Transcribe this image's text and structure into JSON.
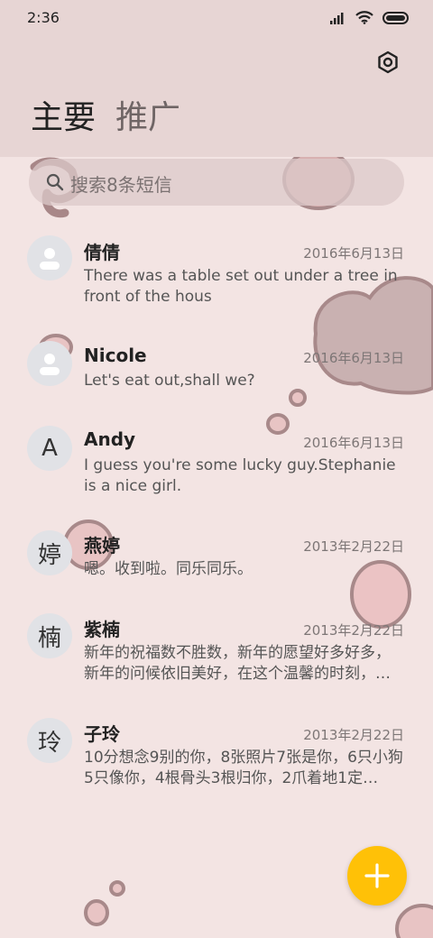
{
  "status_bar": {
    "time": "2:36"
  },
  "header": {
    "tabs": [
      {
        "label": "主要"
      },
      {
        "label": "推广"
      }
    ]
  },
  "search": {
    "placeholder": "搜索8条短信"
  },
  "messages": [
    {
      "name": "倩倩",
      "date": "2016年6月13日",
      "preview": "There was a table set out under a tree in front of the hous",
      "avatar": ""
    },
    {
      "name": "Nicole",
      "date": "2016年6月13日",
      "preview": "Let's eat out,shall we?",
      "avatar": ""
    },
    {
      "name": "Andy",
      "date": "2016年6月13日",
      "preview": "I guess you're some lucky guy.Stephanie is a nice girl.",
      "avatar": "A"
    },
    {
      "name": "燕婷",
      "date": "2013年2月22日",
      "preview": "嗯。收到啦。同乐同乐。",
      "avatar": "婷"
    },
    {
      "name": "紫楠",
      "date": "2013年2月22日",
      "preview": "新年的祝福数不胜数，新年的愿望好多好多，新年的问候依旧美好，在这个温馨的时刻，…",
      "avatar": "楠"
    },
    {
      "name": "子玲",
      "date": "2013年2月22日",
      "preview": "10分想念9别的你，8张照片7张是你，6只小狗5只像你，4根骨头3根归你，2爪着地1定…",
      "avatar": "玲"
    }
  ],
  "colors": {
    "fab": "#ffc107",
    "header_bg": "#e7d5d4",
    "page_bg": "#f3e4e3"
  }
}
